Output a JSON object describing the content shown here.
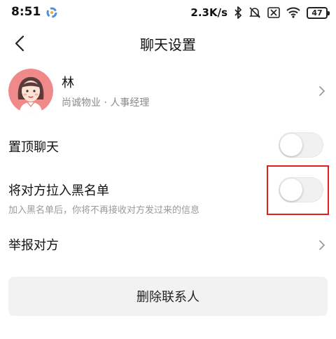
{
  "status_bar": {
    "time": "8:51",
    "network_speed": "2.3K/s",
    "battery": "47",
    "icons": [
      "app-notification-icon",
      "bluetooth-icon",
      "mute-icon",
      "sim-disabled-icon",
      "wifi-icon",
      "battery-icon"
    ]
  },
  "nav": {
    "title": "聊天设置",
    "back_icon": "chevron-left-icon"
  },
  "contact": {
    "name": "林",
    "subtitle": "尚诚物业 · 人事经理",
    "avatar_bg": "#f08a8a"
  },
  "settings": {
    "pin_chat": {
      "label": "置顶聊天",
      "enabled": false
    },
    "blacklist": {
      "label": "将对方拉入黑名单",
      "hint": "加入黑名单后，你将不再接收对方发过来的信息",
      "enabled": false
    },
    "report": {
      "label": "举报对方"
    }
  },
  "actions": {
    "delete_contact": "删除联系人"
  },
  "colors": {
    "highlight": "#e01f1f",
    "button_bg": "#f2f2f2",
    "muted_text": "#8a8a8a"
  }
}
